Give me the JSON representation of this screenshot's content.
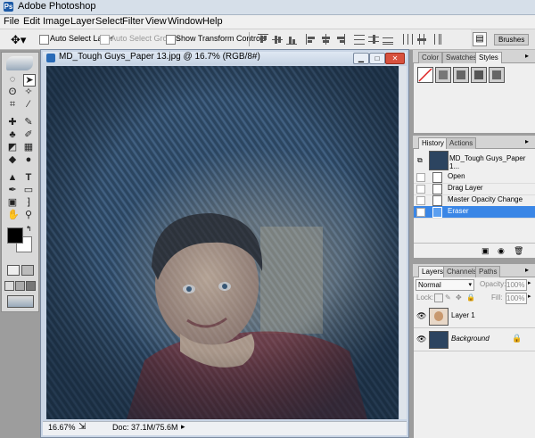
{
  "app": {
    "title": "Adobe Photoshop"
  },
  "menu": [
    "File",
    "Edit",
    "Image",
    "Layer",
    "Select",
    "Filter",
    "View",
    "Window",
    "Help"
  ],
  "options": {
    "auto_select_layer": "Auto Select Layer",
    "auto_select_groups": "Auto Select Groups",
    "show_transform_controls": "Show Transform Controls",
    "brushes_tab": "Brushes"
  },
  "document": {
    "title": "MD_Tough Guys_Paper 13.jpg @ 16.7% (RGB/8#)",
    "zoom": "16.67%",
    "doc_size": "Doc: 37.1M/75.6M"
  },
  "styles_panel": {
    "tabs": [
      "Color",
      "Swatches",
      "Styles"
    ],
    "active_tab": "Styles"
  },
  "history_panel": {
    "tabs": [
      "History",
      "Actions"
    ],
    "snapshot_label": "MD_Tough Guys_Paper 1...",
    "items": [
      "Open",
      "Drag Layer",
      "Master Opacity Change",
      "Eraser"
    ],
    "selected": "Eraser"
  },
  "layers_panel": {
    "tabs": [
      "Layers",
      "Channels",
      "Paths"
    ],
    "blend_mode": "Normal",
    "opacity_label": "Opacity:",
    "opacity_value": "100%",
    "lock_label": "Lock:",
    "fill_label": "Fill:",
    "fill_value": "100%",
    "layers": [
      "Layer 1",
      "Background"
    ]
  },
  "colors": {
    "accent": "#3a86e6",
    "denim": "#2c4460"
  }
}
